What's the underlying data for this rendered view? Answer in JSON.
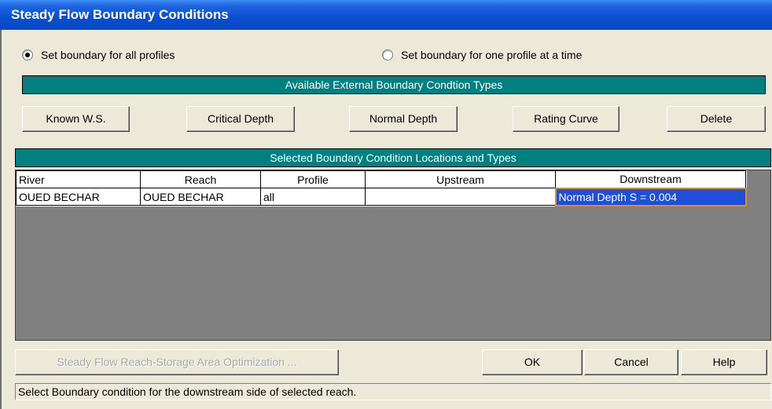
{
  "window": {
    "title": "Steady Flow Boundary Conditions"
  },
  "options": {
    "all_profiles_label": "Set boundary for all profiles",
    "all_profiles_selected": true,
    "one_profile_label": "Set boundary for one profile at a time",
    "one_profile_selected": false
  },
  "available_types": {
    "header": "Available External Boundary Condtion Types",
    "buttons": [
      "Known W.S.",
      "Critical Depth",
      "Normal Depth",
      "Rating Curve",
      "Delete"
    ]
  },
  "selected": {
    "header": "Selected Boundary Condition Locations and Types",
    "columns": [
      "River",
      "Reach",
      "Profile",
      "Upstream",
      "Downstream"
    ],
    "rows": [
      {
        "river": "OUED BECHAR",
        "reach": "OUED BECHAR",
        "profile": "all",
        "upstream": "",
        "downstream": "Normal Depth S = 0.004"
      }
    ]
  },
  "footer": {
    "optimization_label": "Steady Flow Reach-Storage Area Optimization ...",
    "ok_label": "OK",
    "cancel_label": "Cancel",
    "help_label": "Help"
  },
  "status_text": "Select Boundary condition for the downstream side of selected reach.",
  "colors": {
    "header_bar": "#008080",
    "title_bar": "#0a4fd1",
    "selection": "#1f4ed8",
    "grid_background": "#808080"
  }
}
